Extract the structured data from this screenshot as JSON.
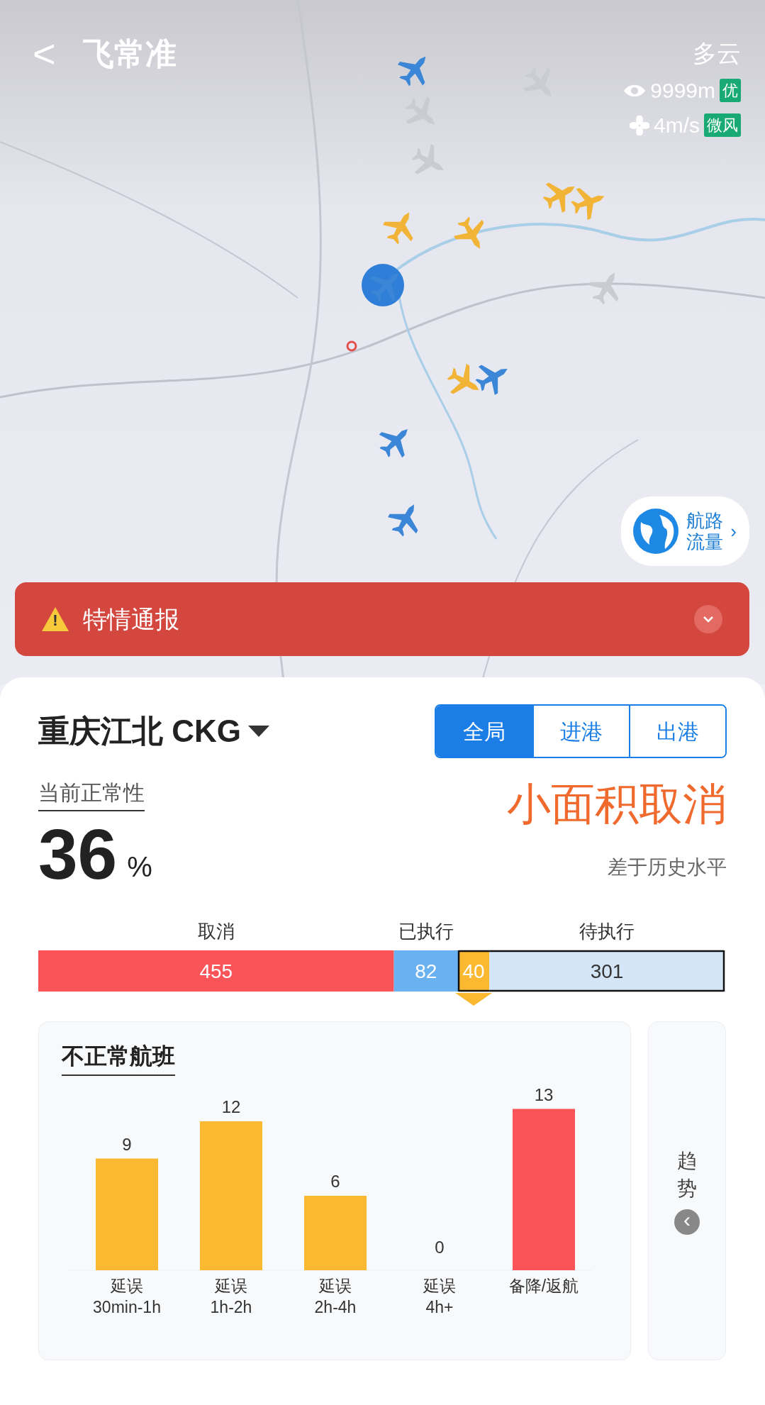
{
  "header": {
    "back": "<",
    "logo": "飞常准"
  },
  "weather": {
    "condition": "多云",
    "visibility": "9999m",
    "visibility_grade": "优",
    "wind": "4m/s",
    "wind_grade": "微风"
  },
  "map": {
    "planes": [
      {
        "color": "#3b86d6"
      },
      {
        "color": "#c9ccd2"
      },
      {
        "color": "#c9ccd2"
      },
      {
        "color": "#f2b437"
      },
      {
        "color": "#f2b437"
      },
      {
        "color": "#f2b437"
      },
      {
        "color": "#f2b437"
      },
      {
        "color": "#c9ccd2"
      },
      {
        "color": "#c9ccd2"
      },
      {
        "color": "#3b86d6"
      },
      {
        "color": "#f2b437"
      },
      {
        "color": "#3b86d6"
      },
      {
        "color": "#3b86d6"
      },
      {
        "color": "#3b86d6"
      }
    ]
  },
  "route_button": {
    "label_lines": [
      "航路",
      "流量"
    ],
    "arrow": "›"
  },
  "alert": {
    "icon": "!",
    "title": "特情通报",
    "expanded": false
  },
  "airport": {
    "name": "重庆江北 CKG"
  },
  "tabs": [
    {
      "label": "全局",
      "selected": true
    },
    {
      "label": "进港",
      "selected": false
    },
    {
      "label": "出港",
      "selected": false
    }
  ],
  "normality": {
    "label": "当前正常性",
    "value": "36",
    "unit": "%",
    "status": "小面积取消",
    "comparison": "差于历史水平"
  },
  "flights_bar": {
    "chart_data": {
      "type": "bar",
      "orientation": "horizontal",
      "stacked": true,
      "data_labels": true,
      "series": [
        {
          "name": "取消",
          "color": "#fa5459",
          "values": [
            455
          ]
        },
        {
          "name": "已执行",
          "color": "#6ab1f2",
          "values": [
            82
          ]
        },
        {
          "color": "#fbb932",
          "values": [
            40
          ]
        },
        {
          "name": "待执行",
          "color": "#d3e5f6",
          "values": [
            301
          ]
        }
      ]
    },
    "segment_states": [
      {
        "outlined": false,
        "selected": false
      },
      {
        "outlined": false,
        "selected": false
      },
      {
        "outlined": true,
        "selected": true
      },
      {
        "outlined": true,
        "selected": false
      }
    ]
  },
  "abnormal": {
    "title": "不正常航班",
    "chart_data": {
      "type": "bar",
      "categories": [
        "延误\n30min-1h",
        "延误\n1h-2h",
        "延误\n2h-4h",
        "延误\n4h+",
        "备降/返航"
      ],
      "series": [
        {
          "color": "#fbb932",
          "values": [
            9,
            12,
            6,
            0,
            null
          ]
        },
        {
          "color": "#fa5459",
          "values": [
            null,
            null,
            null,
            null,
            13
          ]
        }
      ],
      "stacked": true,
      "data_labels": true
    }
  },
  "trend": {
    "label": "趋势",
    "arrow": "‹"
  }
}
